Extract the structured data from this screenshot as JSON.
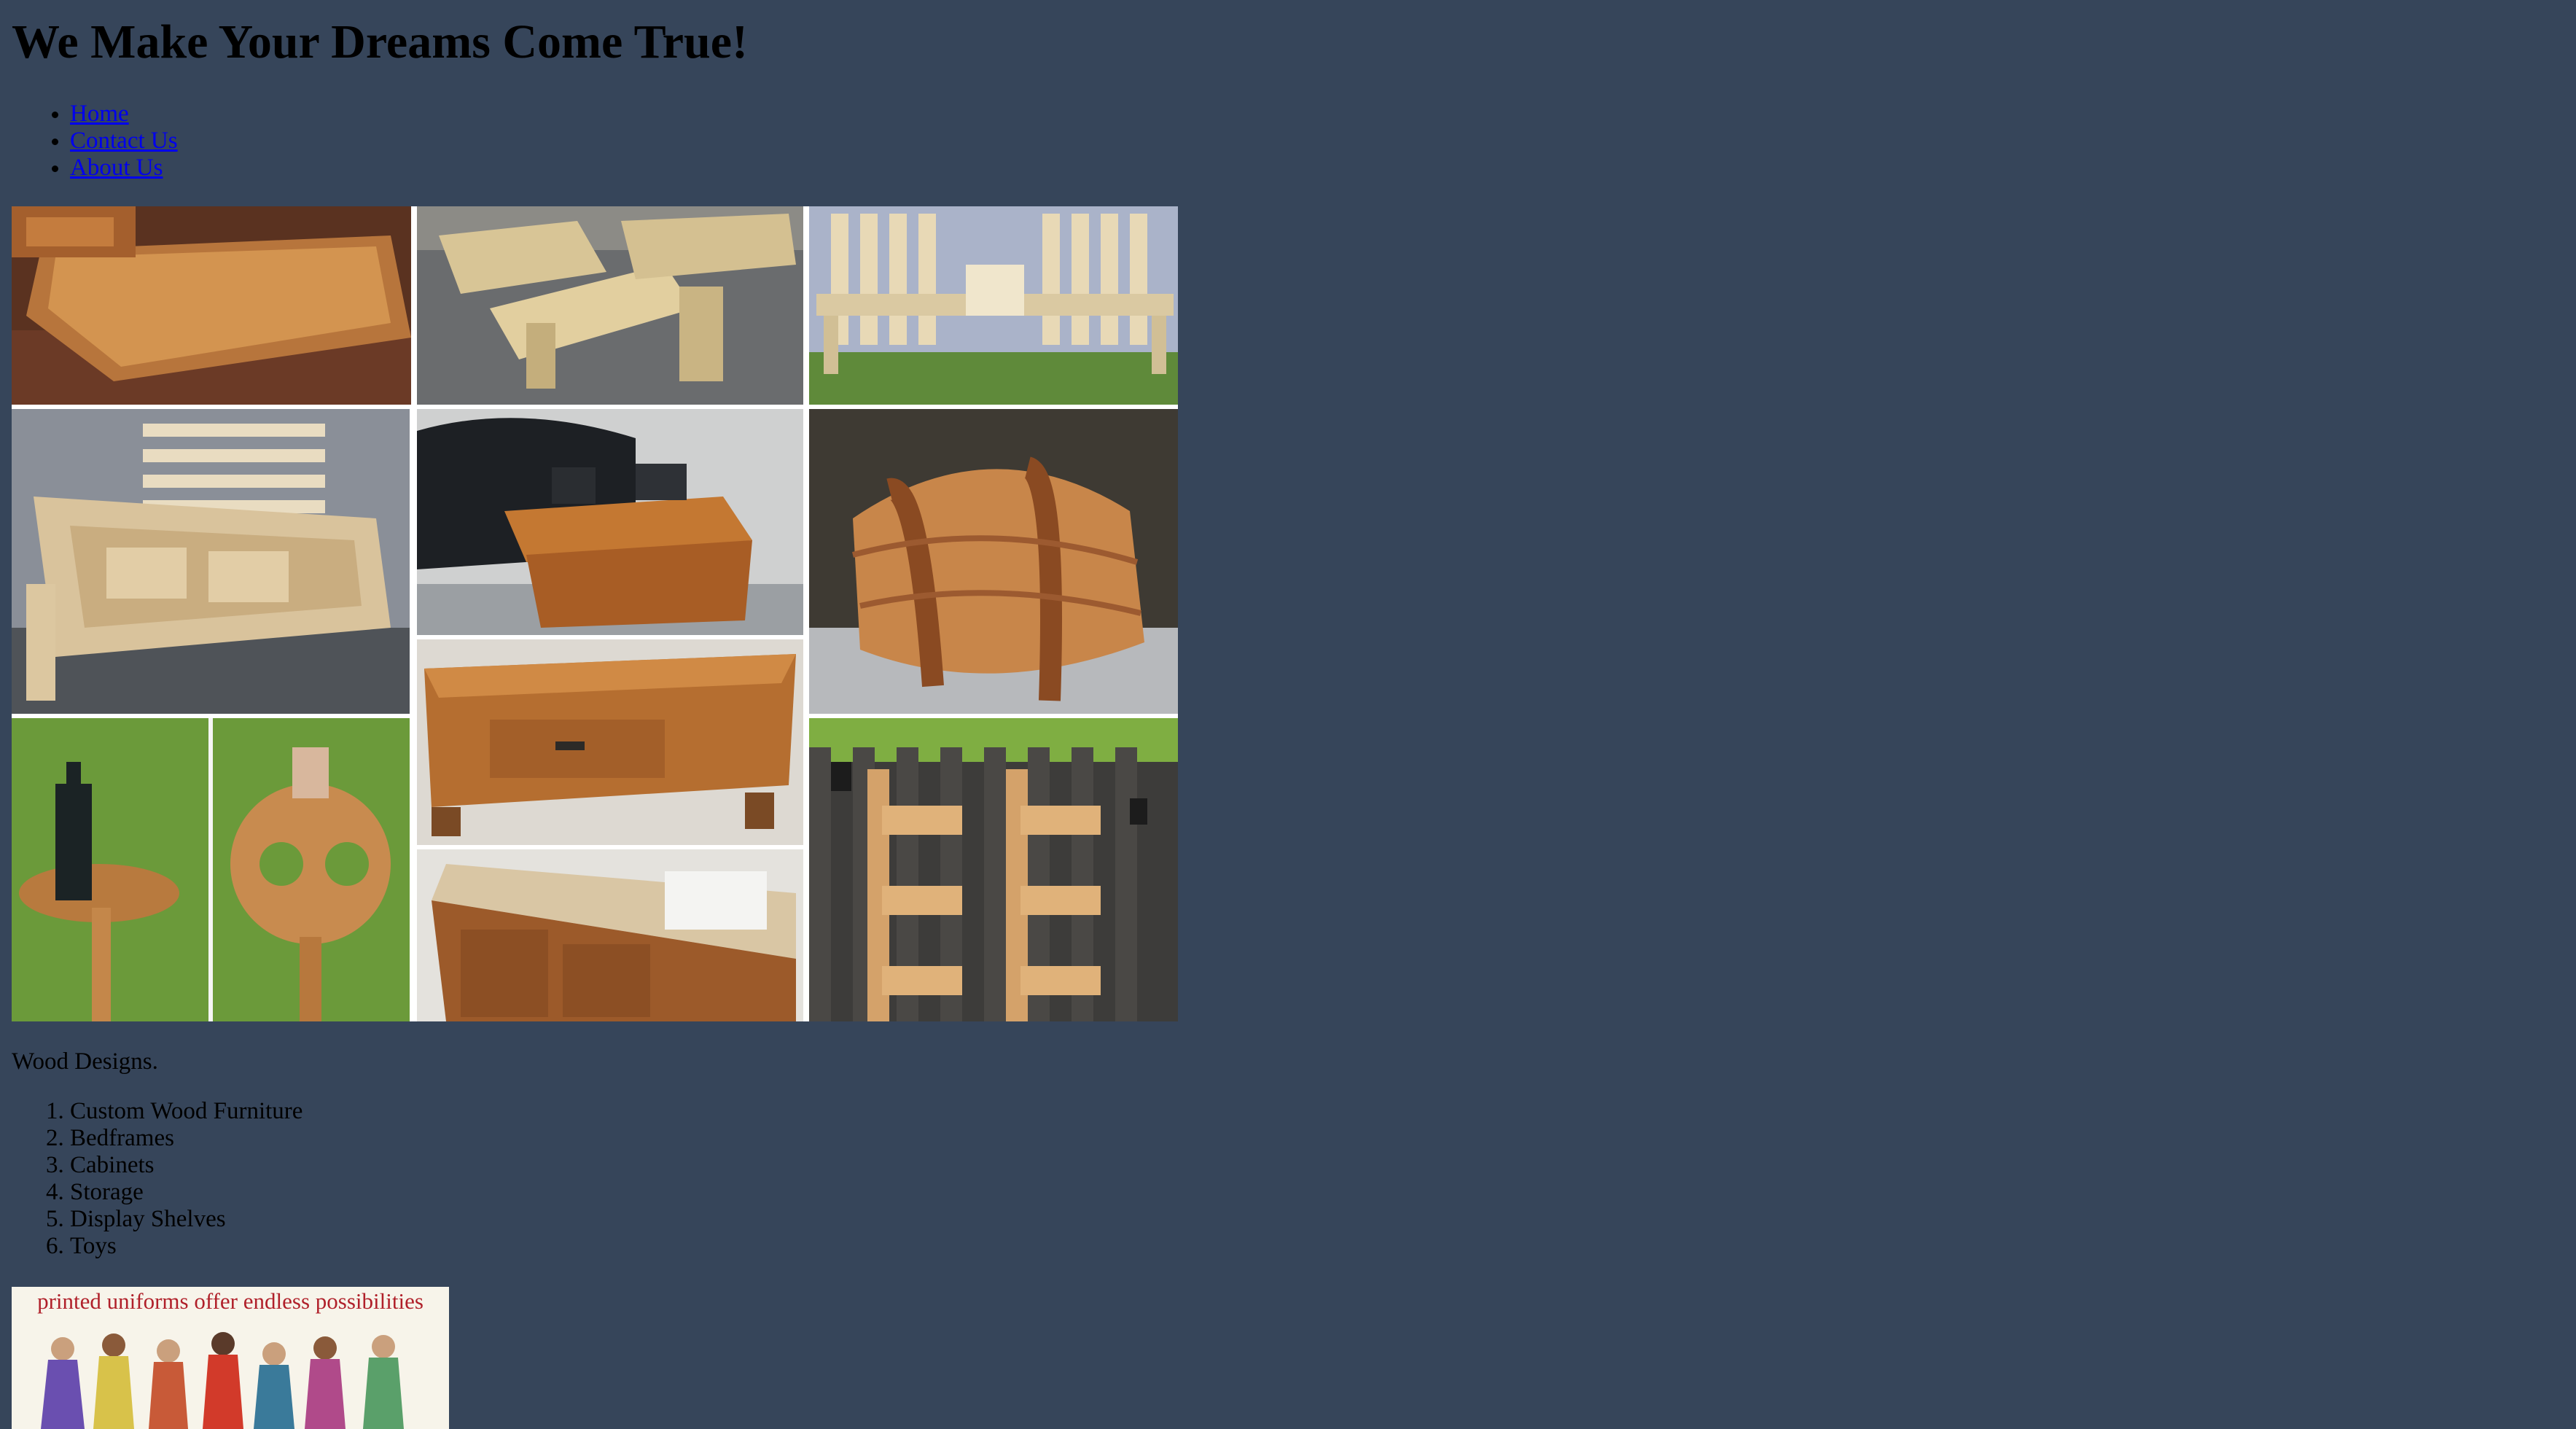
{
  "header": {
    "title": "We Make Your Dreams Come True!"
  },
  "nav": {
    "items": [
      {
        "label": "Home"
      },
      {
        "label": "Contact Us"
      },
      {
        "label": "About Us"
      }
    ]
  },
  "gallery": {
    "caption": "Wood Designs."
  },
  "designs": {
    "items": [
      "Custom Wood Furniture",
      "Bedframes",
      "Cabinets",
      "Storage",
      "Display Shelves",
      "Toys"
    ]
  },
  "ad": {
    "text": "printed uniforms offer endless possibilities"
  }
}
